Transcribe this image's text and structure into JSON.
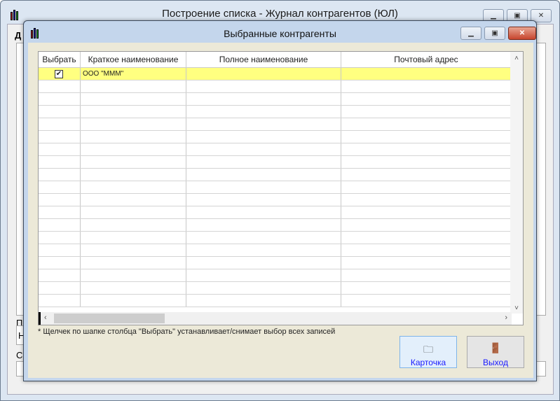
{
  "main_window": {
    "title": "Построение списка - Журнал контрагентов (ЮЛ)",
    "label_d": "Д",
    "label_p": "П",
    "label_s": "С",
    "field_value": "Н"
  },
  "dialog": {
    "title": "Выбранные контрагенты",
    "columns": [
      "Выбрать",
      "Краткое наименование",
      "Полное наименование",
      "Почтовый адрес"
    ],
    "rows": [
      {
        "checked": true,
        "short_name": "ООО \"МММ\"",
        "full_name": "",
        "address": ""
      }
    ],
    "note": "* Щелчек по шапке столбца \"Выбрать\" устанавливает/снимает выбор всех записей",
    "buttons": {
      "card": "Карточка",
      "exit": "Выход"
    }
  }
}
